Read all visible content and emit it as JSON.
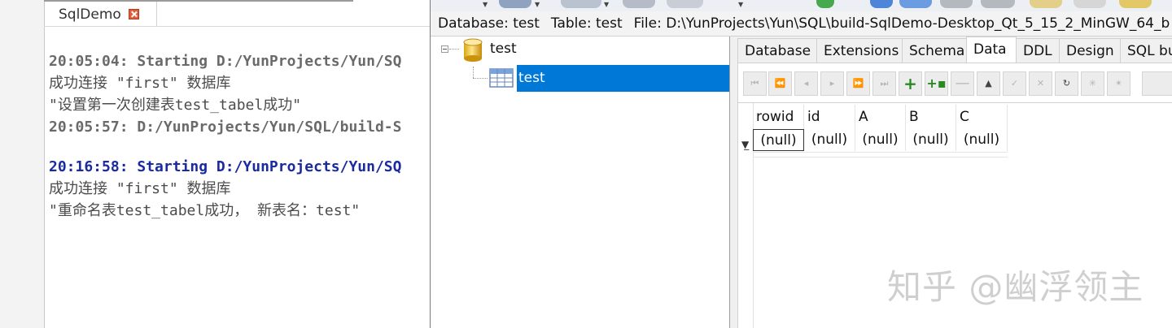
{
  "qt_creator": {
    "tab_title": "SqlDemo",
    "output_lines": [
      {
        "text": "20:05:04: Starting D:/YunProjects/Yun/SQ",
        "style": "grey"
      },
      {
        "text": "成功连接 \"first\" 数据库",
        "style": "cjk"
      },
      {
        "text": "\"设置第一次创建表test_tabel成功\"",
        "style": "cjk"
      },
      {
        "text": "20:05:57: D:/YunProjects/Yun/SQL/build-S",
        "style": "grey"
      },
      {
        "text": "",
        "style": "blank"
      },
      {
        "text": "20:16:58: Starting D:/YunProjects/Yun/SQ",
        "style": "blue"
      },
      {
        "text": "成功连接 \"first\" 数据库",
        "style": "cjk"
      },
      {
        "text": "\"重命名表test_tabel成功， 新表名：test\"",
        "style": "cjk"
      }
    ]
  },
  "sqlite_expert": {
    "path_bar": {
      "database": "Database: test",
      "table": "Table: test",
      "file": "File: D:\\YunProjects\\Yun\\SQL\\build-SqlDemo-Desktop_Qt_5_15_2_MinGW_64_b"
    },
    "tree": {
      "database_name": "test",
      "table_name": "test"
    },
    "tabs": [
      "Database",
      "Extensions",
      "Schema",
      "Data",
      "DDL",
      "Design",
      "SQL bu"
    ],
    "active_tab": "Data",
    "nav_buttons": [
      "first-icon",
      "prior-page-icon",
      "prior-icon",
      "next-icon",
      "next-page-icon",
      "last-icon",
      "insert-icon",
      "insert-copy-icon",
      "delete-icon",
      "edit-icon",
      "post-icon",
      "cancel-icon",
      "refresh-icon",
      "clear-icon",
      "set-null-icon"
    ],
    "grid": {
      "columns": [
        "rowid",
        "id",
        "A",
        "B",
        "C"
      ],
      "rows": [
        [
          "(null)",
          "(null)",
          "(null)",
          "(null)",
          "(null)"
        ]
      ]
    }
  },
  "watermark": "知乎 @幽浮领主"
}
